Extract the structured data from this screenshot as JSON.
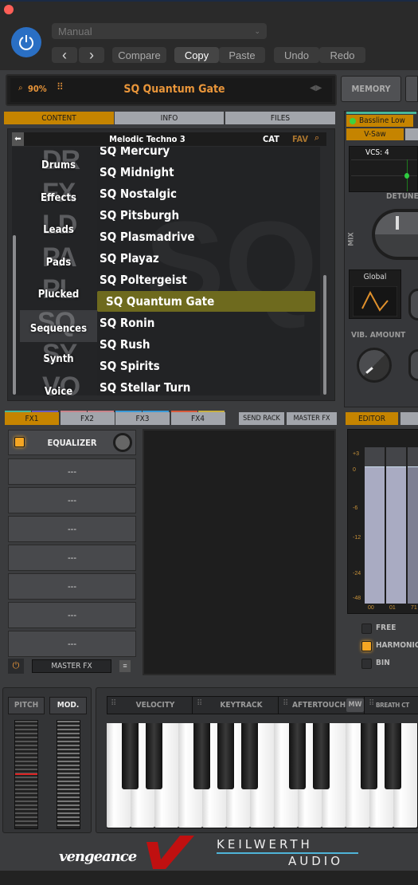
{
  "host": {
    "preset_dropdown": "Manual",
    "prev": "‹",
    "next": "›",
    "compare": "Compare",
    "copy": "Copy",
    "paste": "Paste",
    "undo": "Undo",
    "redo": "Redo"
  },
  "display": {
    "zoom": "90%",
    "preset_name": "SQ Quantum Gate",
    "memory": "MEMORY"
  },
  "browser": {
    "tabs": [
      "CONTENT",
      "INFO",
      "FILES"
    ],
    "folder": "Melodic Techno 3",
    "cat": "CAT",
    "fav": "FAV",
    "categories": [
      {
        "ghost": "DR",
        "label": "Drums"
      },
      {
        "ghost": "FX",
        "label": "Effects"
      },
      {
        "ghost": "LD",
        "label": "Leads"
      },
      {
        "ghost": "PA",
        "label": "Pads"
      },
      {
        "ghost": "PL",
        "label": "Plucked"
      },
      {
        "ghost": "SQ",
        "label": "Sequences"
      },
      {
        "ghost": "SY",
        "label": "Synth"
      },
      {
        "ghost": "VO",
        "label": "Voice"
      }
    ],
    "selected_category": "Sequences",
    "presets": [
      "SQ Mercury",
      "SQ Midnight",
      "SQ Nostalgic",
      "SQ Pitsburgh",
      "SQ Plasmadrive",
      "SQ Playaz",
      "SQ Poltergeist",
      "SQ Quantum Gate",
      "SQ Ronin",
      "SQ Rush",
      "SQ Spirits",
      "SQ Stellar Turn"
    ],
    "selected_preset": "SQ Quantum Gate"
  },
  "osc": {
    "layer": "Bassline Low",
    "wave": "V-Saw",
    "voices": "VCS: 4",
    "detune": "DETUNE",
    "mix": "MIX",
    "lfo_mode": "Global",
    "vib_amount": "VIB. AMOUNT"
  },
  "fx": {
    "tabs": [
      "FX1",
      "FX2",
      "FX3",
      "FX4"
    ],
    "send_rack": "SEND RACK",
    "master_fx": "MASTER FX",
    "slots": [
      "EQUALIZER",
      "---",
      "---",
      "---",
      "---",
      "---",
      "---",
      "---"
    ],
    "footer": "MASTER FX"
  },
  "editor": {
    "tab": "EDITOR",
    "db_labels": [
      "+3",
      "0",
      "-6",
      "-12",
      "-24",
      "-48"
    ],
    "bins": [
      "00",
      "01",
      "71"
    ],
    "modes": [
      "FREE",
      "HARMONIC",
      "BIN"
    ],
    "active_mode": "HARMONIC"
  },
  "perf": {
    "pitch": "PITCH",
    "mod": "MOD.",
    "mods": [
      "VELOCITY",
      "KEYTRACK",
      "AFTERTOUCH",
      "BREATH CT"
    ],
    "mw": "MW"
  },
  "brand": {
    "vengeance": "vengeance",
    "keilwerth": "KEILWERTH",
    "audio": "AUDIO"
  },
  "colors": {
    "accent": "#c58400",
    "preset_text": "#e8953a",
    "selected": "#6e6a1e",
    "power": "#2a6fc4"
  }
}
